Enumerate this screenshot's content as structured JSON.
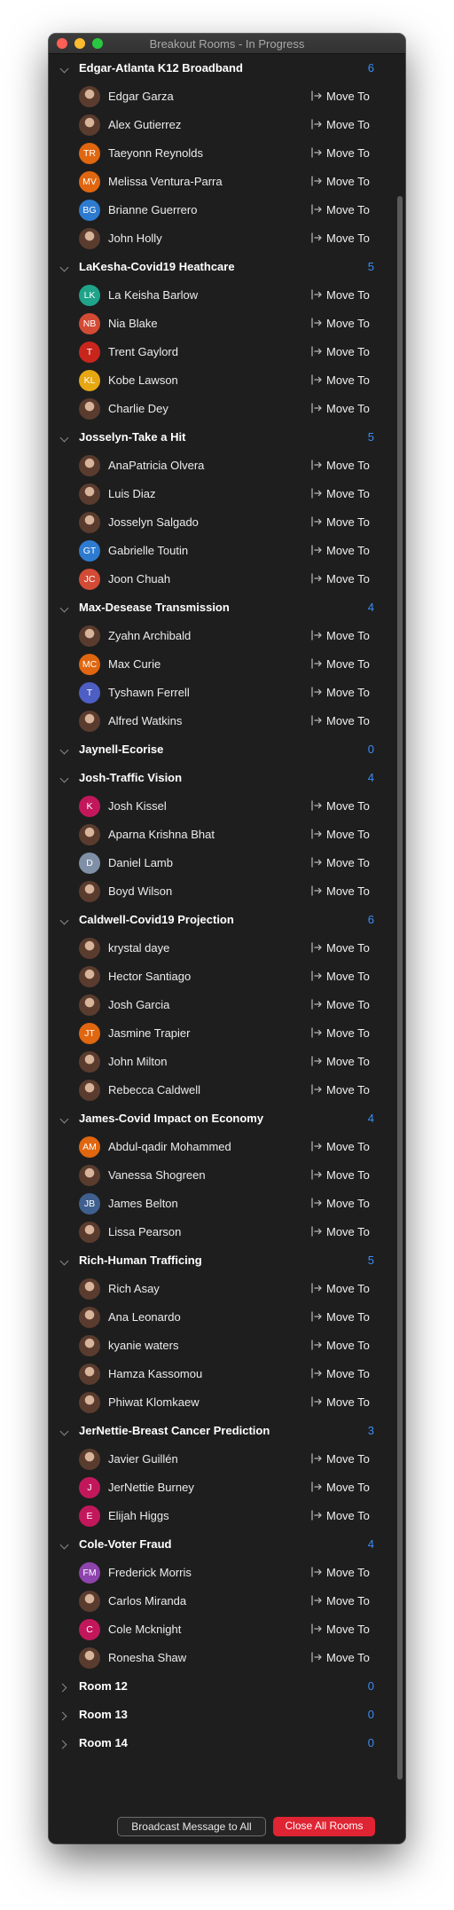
{
  "window": {
    "title": "Breakout Rooms - In Progress"
  },
  "move_label": "Move To",
  "colors": {
    "accent_blue": "#3a8ef6",
    "close_red": "#df2433",
    "window_bg": "#1e1e1e"
  },
  "rooms": [
    {
      "name": "Edgar-Atlanta K12 Broadband",
      "count": "6",
      "expanded": true,
      "participants": [
        {
          "name": "Edgar Garza",
          "initials": "",
          "color": ""
        },
        {
          "name": "Alex Gutierrez",
          "initials": "",
          "color": ""
        },
        {
          "name": "Taeyonn Reynolds",
          "initials": "TR",
          "color": "#e0660f"
        },
        {
          "name": "Melissa Ventura-Parra",
          "initials": "MV",
          "color": "#e0660f"
        },
        {
          "name": "Brianne Guerrero",
          "initials": "BG",
          "color": "#2d7bd0"
        },
        {
          "name": "John Holly",
          "initials": "",
          "color": ""
        }
      ]
    },
    {
      "name": "LaKesha-Covid19 Heathcare",
      "count": "5",
      "expanded": true,
      "participants": [
        {
          "name": "La Keisha Barlow",
          "initials": "LK",
          "color": "#1fa48a"
        },
        {
          "name": "Nia Blake",
          "initials": "NB",
          "color": "#d34b35"
        },
        {
          "name": "Trent Gaylord",
          "initials": "T",
          "color": "#c8261c"
        },
        {
          "name": "Kobe Lawson",
          "initials": "KL",
          "color": "#e7a712"
        },
        {
          "name": "Charlie Dey",
          "initials": "",
          "color": ""
        }
      ]
    },
    {
      "name": "Josselyn-Take a Hit",
      "count": "5",
      "expanded": true,
      "participants": [
        {
          "name": "AnaPatricia Olvera",
          "initials": "",
          "color": ""
        },
        {
          "name": "Luis Diaz",
          "initials": "",
          "color": ""
        },
        {
          "name": "Josselyn Salgado",
          "initials": "",
          "color": ""
        },
        {
          "name": "Gabrielle Toutin",
          "initials": "GT",
          "color": "#2d7bd0"
        },
        {
          "name": "Joon Chuah",
          "initials": "JC",
          "color": "#d34b35"
        }
      ]
    },
    {
      "name": "Max-Desease Transmission",
      "count": "4",
      "expanded": true,
      "participants": [
        {
          "name": "Zyahn Archibald",
          "initials": "",
          "color": ""
        },
        {
          "name": "Max Curie",
          "initials": "MC",
          "color": "#e0660f"
        },
        {
          "name": "Tyshawn Ferrell",
          "initials": "T",
          "color": "#4d5fc4"
        },
        {
          "name": "Alfred Watkins",
          "initials": "",
          "color": ""
        }
      ]
    },
    {
      "name": "Jaynell-Ecorise",
      "count": "0",
      "expanded": true,
      "participants": []
    },
    {
      "name": "Josh-Traffic Vision",
      "count": "4",
      "expanded": true,
      "participants": [
        {
          "name": "Josh Kissel",
          "initials": "K",
          "color": "#c2185b"
        },
        {
          "name": "Aparna Krishna Bhat",
          "initials": "",
          "color": ""
        },
        {
          "name": "Daniel Lamb",
          "initials": "D",
          "color": "#7f8fa6"
        },
        {
          "name": "Boyd Wilson",
          "initials": "",
          "color": ""
        }
      ]
    },
    {
      "name": "Caldwell-Covid19 Projection",
      "count": "6",
      "expanded": true,
      "participants": [
        {
          "name": "krystal daye",
          "initials": "",
          "color": ""
        },
        {
          "name": "Hector Santiago",
          "initials": "",
          "color": ""
        },
        {
          "name": "Josh Garcia",
          "initials": "",
          "color": ""
        },
        {
          "name": "Jasmine Trapier",
          "initials": "JT",
          "color": "#e0660f"
        },
        {
          "name": "John Milton",
          "initials": "",
          "color": ""
        },
        {
          "name": "Rebecca Caldwell",
          "initials": "",
          "color": ""
        }
      ]
    },
    {
      "name": "James-Covid Impact on Economy",
      "count": "4",
      "expanded": true,
      "participants": [
        {
          "name": "Abdul-qadir Mohammed",
          "initials": "AM",
          "color": "#e0660f"
        },
        {
          "name": "Vanessa Shogreen",
          "initials": "",
          "color": ""
        },
        {
          "name": "James Belton",
          "initials": "JB",
          "color": "#3f5f8f"
        },
        {
          "name": "Lissa Pearson",
          "initials": "",
          "color": ""
        }
      ]
    },
    {
      "name": "Rich-Human Trafficing",
      "count": "5",
      "expanded": true,
      "participants": [
        {
          "name": "Rich Asay",
          "initials": "",
          "color": ""
        },
        {
          "name": "Ana Leonardo",
          "initials": "",
          "color": ""
        },
        {
          "name": "kyanie waters",
          "initials": "",
          "color": ""
        },
        {
          "name": "Hamza Kassomou",
          "initials": "",
          "color": ""
        },
        {
          "name": "Phiwat Klomkaew",
          "initials": "",
          "color": ""
        }
      ]
    },
    {
      "name": "JerNettie-Breast Cancer Prediction",
      "count": "3",
      "expanded": true,
      "participants": [
        {
          "name": "Javier Guillén",
          "initials": "",
          "color": ""
        },
        {
          "name": "JerNettie Burney",
          "initials": "J",
          "color": "#c2185b"
        },
        {
          "name": "Elijah Higgs",
          "initials": "E",
          "color": "#c2185b"
        }
      ]
    },
    {
      "name": "Cole-Voter Fraud",
      "count": "4",
      "expanded": true,
      "participants": [
        {
          "name": "Frederick Morris",
          "initials": "FM",
          "color": "#8e44ad"
        },
        {
          "name": "Carlos Miranda",
          "initials": "",
          "color": ""
        },
        {
          "name": "Cole Mcknight",
          "initials": "C",
          "color": "#c2185b"
        },
        {
          "name": "Ronesha Shaw",
          "initials": "",
          "color": ""
        }
      ]
    },
    {
      "name": "Room 12",
      "count": "0",
      "expanded": false,
      "participants": []
    },
    {
      "name": "Room 13",
      "count": "0",
      "expanded": false,
      "participants": []
    },
    {
      "name": "Room 14",
      "count": "0",
      "expanded": false,
      "participants": []
    }
  ],
  "footer": {
    "broadcast_label": "Broadcast Message to All",
    "close_label": "Close All Rooms"
  }
}
